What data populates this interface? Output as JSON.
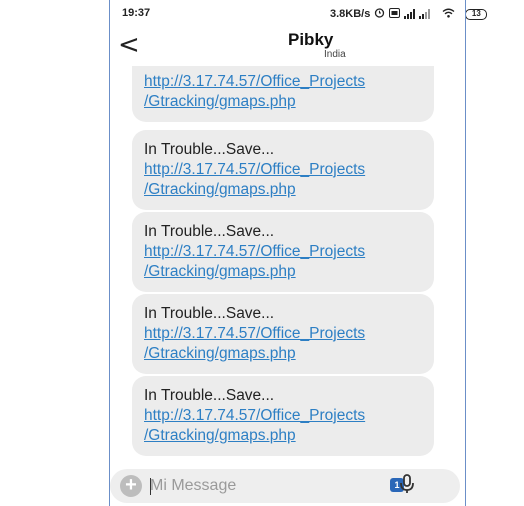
{
  "status_bar": {
    "time": "19:37",
    "network_speed": "3.8KB/s",
    "battery_level": "13",
    "icons": [
      "alarm-icon",
      "volte-icon",
      "signal-icon",
      "signal-icon-2",
      "wifi-icon",
      "battery-icon"
    ]
  },
  "header": {
    "back_label": "<",
    "contact_name": "Pibky",
    "contact_location": "India"
  },
  "messages": [
    {
      "text": "",
      "link_line1": "http://3.17.74.57/Office_Projects",
      "link_line2": "/Gtracking/gmaps.php"
    },
    {
      "text": "In Trouble...Save...",
      "link_line1": "http://3.17.74.57/Office_Projects",
      "link_line2": "/Gtracking/gmaps.php"
    },
    {
      "text": "In Trouble...Save...",
      "link_line1": "http://3.17.74.57/Office_Projects",
      "link_line2": "/Gtracking/gmaps.php"
    },
    {
      "text": "In Trouble...Save...",
      "link_line1": "http://3.17.74.57/Office_Projects",
      "link_line2": "/Gtracking/gmaps.php"
    },
    {
      "text": "In Trouble...Save...",
      "link_line1": "http://3.17.74.57/Office_Projects",
      "link_line2": "/Gtracking/gmaps.php"
    }
  ],
  "composer": {
    "placeholder": "Mi Message",
    "add_label": "+",
    "sim_label": "1"
  },
  "colors": {
    "link": "#2d7fc4",
    "bubble": "#ececec",
    "sim_badge": "#2a67b8"
  }
}
